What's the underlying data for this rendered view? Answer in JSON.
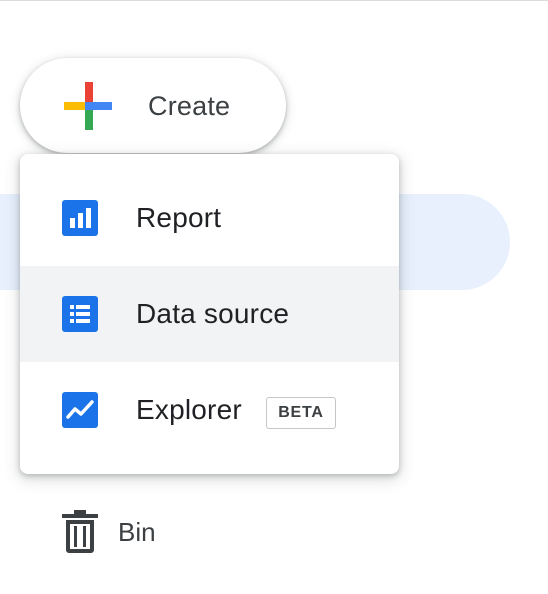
{
  "create": {
    "label": "Create",
    "icon": "google-plus-icon"
  },
  "menu": {
    "items": [
      {
        "label": "Report",
        "icon": "report-icon",
        "hovered": false
      },
      {
        "label": "Data source",
        "icon": "data-source-icon",
        "hovered": true
      },
      {
        "label": "Explorer",
        "icon": "explorer-icon",
        "badge": "BETA",
        "hovered": false
      }
    ]
  },
  "nav": {
    "bin": {
      "label": "Bin",
      "icon": "trash-icon"
    }
  },
  "colors": {
    "accent_blue": "#1a73e8",
    "plus_red": "#ea4335",
    "plus_yellow": "#fbbc04",
    "plus_green": "#34a853",
    "plus_blue": "#4285f4",
    "selected_nav_bg": "#e8f0fe",
    "hover_bg": "#f1f3f4"
  }
}
